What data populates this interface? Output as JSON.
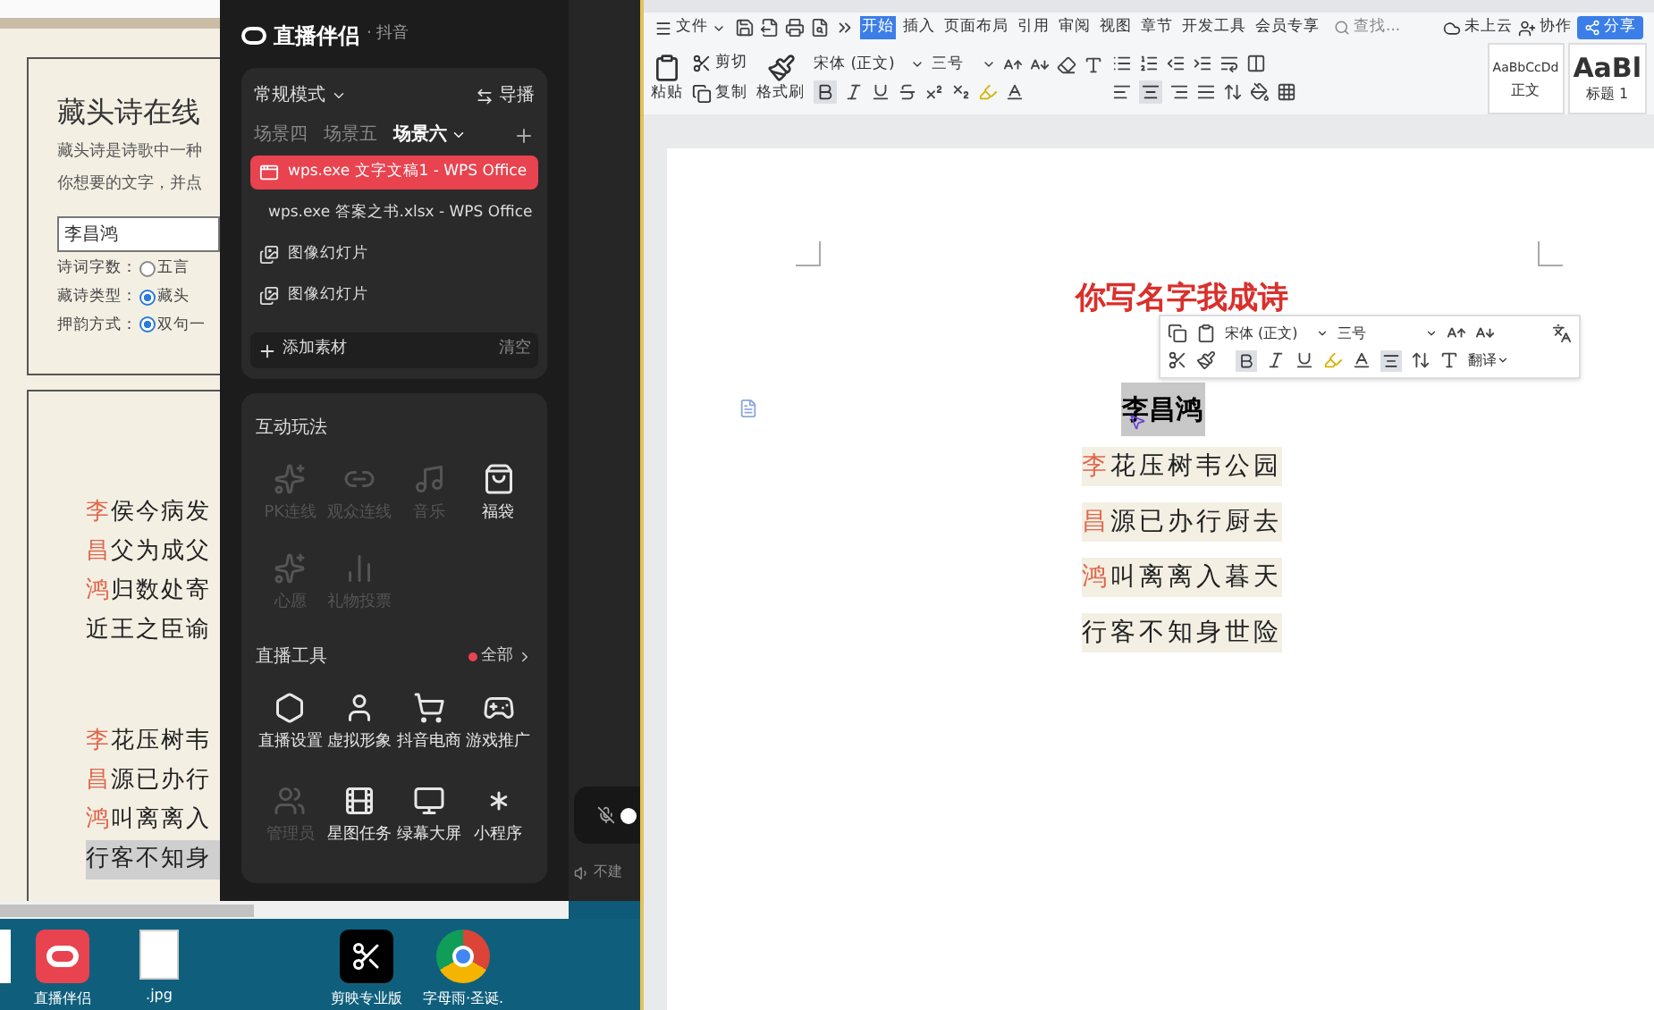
{
  "browser": {
    "title": "藏头诗在线",
    "description": [
      "藏头诗是诗歌中一种",
      "你想要的文字，并点"
    ],
    "name_input": {
      "value": "李昌鸿"
    },
    "options": [
      {
        "label": "诗词字数：",
        "choice": "五言",
        "selected": false
      },
      {
        "label": "藏诗类型：",
        "choice": "藏头",
        "selected": true
      },
      {
        "label": "押韵方式：",
        "choice": "双句一",
        "selected": true
      }
    ],
    "poems": [
      {
        "lines": [
          {
            "head": "李",
            "rest": "侯今病发",
            "highlighted": false
          },
          {
            "head": "昌",
            "rest": "父为成父",
            "highlighted": false
          },
          {
            "head": "鸿",
            "rest": "归数处寄",
            "highlighted": false
          },
          {
            "rest": "近王之臣谕",
            "highlighted": false
          }
        ]
      },
      {
        "lines": [
          {
            "head": "李",
            "rest": "花压树韦",
            "highlighted": false
          },
          {
            "head": "昌",
            "rest": "源已办行",
            "highlighted": false
          },
          {
            "head": "鸿",
            "rest": "叫离离入",
            "highlighted": false
          },
          {
            "rest": "行客不知身",
            "highlighted": true
          }
        ]
      }
    ]
  },
  "stream_app": {
    "name": "直播伴侣",
    "platform": "· 抖音",
    "mode": "常规模式",
    "director": "导播",
    "scenes": [
      {
        "label": "场景四",
        "selected": false
      },
      {
        "label": "场景五",
        "selected": false
      },
      {
        "label": "场景六",
        "selected": true
      }
    ],
    "sources": [
      {
        "label": "wps.exe 文字文稿1 - WPS Office",
        "kind": "window",
        "selected": true
      },
      {
        "label": "wps.exe 答案之书.xlsx - WPS Office",
        "kind": "window",
        "selected": false
      },
      {
        "label": "图像幻灯片",
        "kind": "slides",
        "selected": false
      },
      {
        "label": "图像幻灯片",
        "kind": "slides",
        "selected": false
      }
    ],
    "add_source": "添加素材",
    "clear": "清空",
    "interactive": {
      "title": "互动玩法",
      "items": [
        {
          "label": "PK连线",
          "kind": "pk",
          "disabled": true
        },
        {
          "label": "观众连线",
          "kind": "link",
          "disabled": true
        },
        {
          "label": "音乐",
          "kind": "music",
          "disabled": true
        },
        {
          "label": "福袋",
          "kind": "bag",
          "disabled": false
        },
        {
          "label": "心愿",
          "kind": "wish",
          "disabled": true
        },
        {
          "label": "礼物投票",
          "kind": "vote",
          "disabled": true
        }
      ]
    },
    "tools": {
      "title": "直播工具",
      "all": "全部",
      "items": [
        {
          "label": "直播设置",
          "kind": "settings",
          "disabled": false
        },
        {
          "label": "虚拟形象",
          "kind": "avatar",
          "disabled": false
        },
        {
          "label": "抖音电商",
          "kind": "cart",
          "disabled": false
        },
        {
          "label": "游戏推广",
          "kind": "game",
          "disabled": false
        },
        {
          "label": "管理员",
          "kind": "admin",
          "disabled": true
        },
        {
          "label": "星图任务",
          "kind": "task",
          "disabled": false
        },
        {
          "label": "绿幕大屏",
          "kind": "screen",
          "disabled": false
        },
        {
          "label": "小程序",
          "kind": "mini",
          "disabled": false
        }
      ]
    }
  },
  "side_panel": {
    "hint": "不建"
  },
  "desktop": [
    {
      "label": "直播伴侣",
      "kind": "stream"
    },
    {
      "label": ".jpg",
      "kind": "image"
    },
    {
      "label": "剪映专业版",
      "kind": "editor"
    },
    {
      "label": "字母雨·圣诞.",
      "kind": "browser"
    }
  ],
  "wps": {
    "file_menu": "文件",
    "tabs": [
      {
        "label": "开始",
        "selected": true
      },
      {
        "label": "插入",
        "selected": false
      },
      {
        "label": "页面布局",
        "selected": false
      },
      {
        "label": "引用",
        "selected": false
      },
      {
        "label": "审阅",
        "selected": false
      },
      {
        "label": "视图",
        "selected": false
      },
      {
        "label": "章节",
        "selected": false
      },
      {
        "label": "开发工具",
        "selected": false
      },
      {
        "label": "会员专享",
        "selected": false
      }
    ],
    "search": {
      "placeholder": "查找..."
    },
    "cloud": "未上云",
    "collab": "协作",
    "share": "分享",
    "ribbon": {
      "paste": "粘贴",
      "cut": "剪切",
      "copy": "复制",
      "format_painter": "格式刷",
      "font": "宋体 (正文)",
      "size": "三号",
      "bold": true,
      "align_center": true,
      "styles": [
        {
          "preview": "AaBbCcDd",
          "name": "正文",
          "large": false
        },
        {
          "preview": "AaBl",
          "name": "标题 1",
          "large": true
        }
      ]
    }
  },
  "document": {
    "title": "你写名字我成诗",
    "float_toolbar": {
      "font": "宋体 (正文)",
      "size": "三号",
      "bold": true,
      "align_center": true,
      "translate": "翻译"
    },
    "name": "李昌鸿",
    "lines": [
      {
        "head": "李",
        "rest": "花压树韦公园"
      },
      {
        "head": "昌",
        "rest": "源已办行厨去"
      },
      {
        "head": "鸿",
        "rest": "叫离离入暮天"
      },
      {
        "rest": "行客不知身世险"
      }
    ]
  }
}
